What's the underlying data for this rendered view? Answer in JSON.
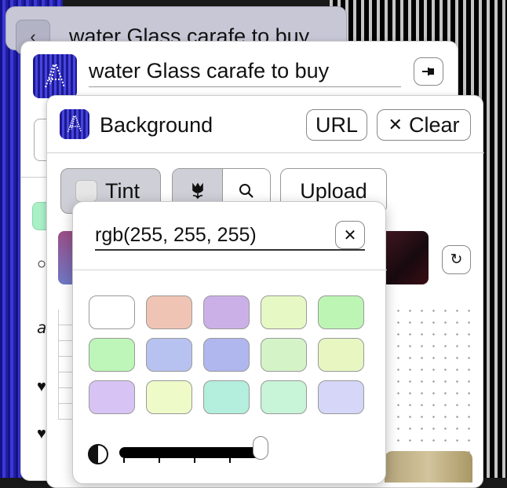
{
  "search": {
    "query": "water Glass carafe to buy",
    "back_icon": "chevron-left-icon"
  },
  "item_panel": {
    "title": "water Glass carafe to buy",
    "pin_icon": "pin-icon"
  },
  "background_panel": {
    "title": "Background",
    "url_button": "URL",
    "clear_button": "Clear",
    "clear_icon": "close-icon",
    "tint_button": "Tint",
    "upload_button": "Upload",
    "flower_icon": "tulip-icon",
    "search_icon": "search-icon",
    "rotate_icon": "rotate-icon"
  },
  "color_picker": {
    "value": "rgb(255, 255, 255)",
    "clear_icon": "close-icon",
    "swatches": [
      "#ffffff",
      "#f0c4b4",
      "#cbb0e8",
      "#e6f9c4",
      "#bdf6b4",
      "#bdf6b8",
      "#b8c2f0",
      "#b0b6ee",
      "#d4f4c8",
      "#e8f6c2",
      "#d8c4f4",
      "#eefac8",
      "#b4eedc",
      "#c8f4d8",
      "#d6d6f8"
    ],
    "opacity_slider_value": 1.0,
    "contrast_icon": "contrast-icon"
  }
}
